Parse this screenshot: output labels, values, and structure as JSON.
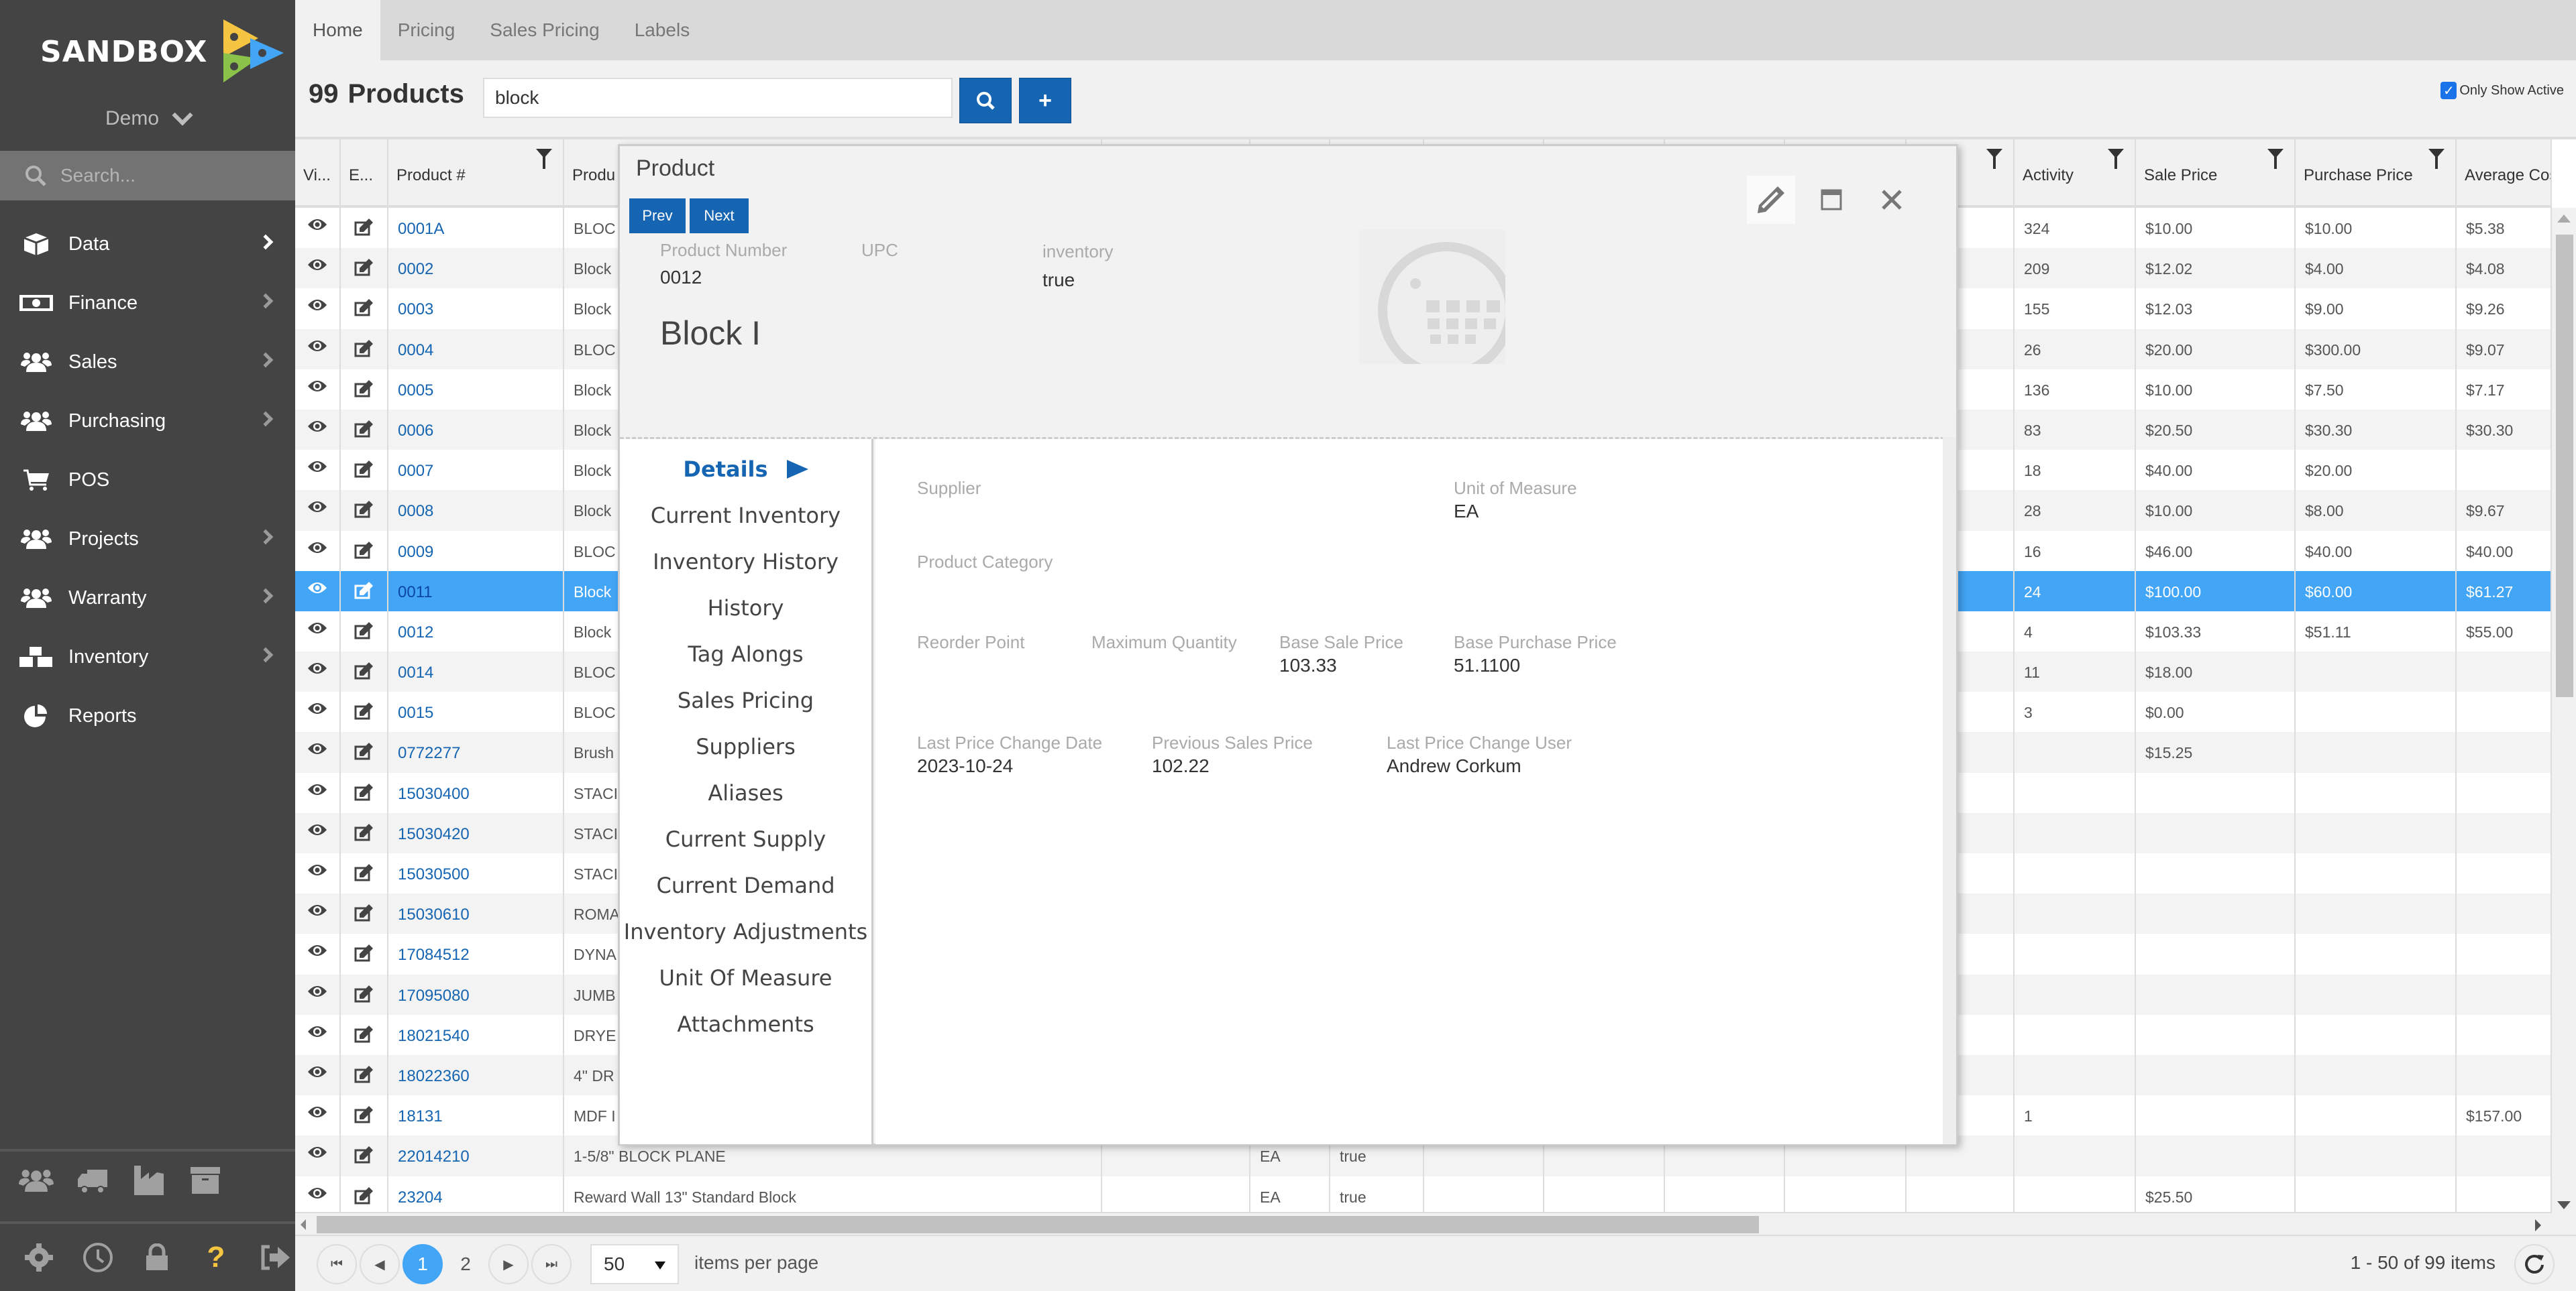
{
  "sidebar": {
    "brand": "SANDBOX",
    "tenant": "Demo",
    "search_placeholder": "Search...",
    "items": [
      {
        "label": "Data",
        "icon": "cube-icon",
        "has_arrow": true
      },
      {
        "label": "Finance",
        "icon": "money-bill-icon",
        "has_arrow": true
      },
      {
        "label": "Sales",
        "icon": "users-icon",
        "has_arrow": true
      },
      {
        "label": "Purchasing",
        "icon": "users-icon",
        "has_arrow": true
      },
      {
        "label": "POS",
        "icon": "shopping-cart-icon",
        "has_arrow": false
      },
      {
        "label": "Projects",
        "icon": "users-icon",
        "has_arrow": true
      },
      {
        "label": "Warranty",
        "icon": "users-icon",
        "has_arrow": true
      },
      {
        "label": "Inventory",
        "icon": "cubes-icon",
        "has_arrow": true
      },
      {
        "label": "Reports",
        "icon": "pie-chart-icon",
        "has_arrow": false
      }
    ],
    "quick_icons": [
      "users-icon",
      "truck-icon",
      "industry-icon",
      "archive-icon"
    ],
    "bottom_icons": [
      "gear-icon",
      "clock-icon",
      "lock-icon",
      "help-icon",
      "sign-out-icon"
    ],
    "help_color": "#f5c542"
  },
  "tabs": [
    {
      "label": "Home",
      "active": true
    },
    {
      "label": "Pricing",
      "active": false
    },
    {
      "label": "Sales Pricing",
      "active": false
    },
    {
      "label": "Labels",
      "active": false
    }
  ],
  "header": {
    "count": "99",
    "title": "Products",
    "search_value": "block",
    "only_show_active_label": "Only Show Active",
    "only_show_active_checked": true
  },
  "grid": {
    "columns": [
      "Vi...",
      "E...",
      "Product #",
      "Produ",
      "",
      "",
      "",
      "",
      "",
      "",
      "",
      "",
      "Activity",
      "Sale Price",
      "Purchase Price",
      "Average Cos"
    ],
    "rows": [
      {
        "num": "0001A",
        "desc": "BLOC",
        "uom": "",
        "active": "",
        "activity": "324",
        "sale": "$10.00",
        "purchase": "$10.00",
        "avg": "$5.38"
      },
      {
        "num": "0002",
        "desc": "Block",
        "uom": "",
        "active": "",
        "activity": "209",
        "sale": "$12.02",
        "purchase": "$4.00",
        "avg": "$4.08"
      },
      {
        "num": "0003",
        "desc": "Block",
        "uom": "",
        "active": "",
        "activity": "155",
        "sale": "$12.03",
        "purchase": "$9.00",
        "avg": "$9.26"
      },
      {
        "num": "0004",
        "desc": "BLOC",
        "uom": "",
        "active": "",
        "activity": "26",
        "sale": "$20.00",
        "purchase": "$300.00",
        "avg": "$9.07"
      },
      {
        "num": "0005",
        "desc": "Block",
        "uom": "",
        "active": "",
        "activity": "136",
        "sale": "$10.00",
        "purchase": "$7.50",
        "avg": "$7.17"
      },
      {
        "num": "0006",
        "desc": "Block",
        "uom": "",
        "active": "",
        "activity": "83",
        "sale": "$20.50",
        "purchase": "$30.30",
        "avg": "$30.30"
      },
      {
        "num": "0007",
        "desc": "Block",
        "uom": "",
        "active": "",
        "activity": "18",
        "sale": "$40.00",
        "purchase": "$20.00",
        "avg": ""
      },
      {
        "num": "0008",
        "desc": "Block",
        "uom": "",
        "active": "",
        "activity": "28",
        "sale": "$10.00",
        "purchase": "$8.00",
        "avg": "$9.67"
      },
      {
        "num": "0009",
        "desc": "BLOC",
        "uom": "",
        "active": "",
        "activity": "16",
        "sale": "$46.00",
        "purchase": "$40.00",
        "avg": "$40.00"
      },
      {
        "num": "0011",
        "desc": "Block",
        "uom": "",
        "active": "",
        "activity": "24",
        "sale": "$100.00",
        "purchase": "$60.00",
        "avg": "$61.27",
        "selected": true
      },
      {
        "num": "0012",
        "desc": "Block",
        "uom": "",
        "active": "",
        "activity": "4",
        "sale": "$103.33",
        "purchase": "$51.11",
        "avg": "$55.00"
      },
      {
        "num": "0014",
        "desc": "BLOC",
        "uom": "",
        "active": "",
        "activity": "11",
        "sale": "$18.00",
        "purchase": "",
        "avg": ""
      },
      {
        "num": "0015",
        "desc": "BLOC",
        "uom": "",
        "active": "",
        "activity": "3",
        "sale": "$0.00",
        "purchase": "",
        "avg": ""
      },
      {
        "num": "0772277",
        "desc": "Brush",
        "uom": "",
        "active": "",
        "activity": "",
        "sale": "$15.25",
        "purchase": "",
        "avg": ""
      },
      {
        "num": "15030400",
        "desc": "STACI",
        "uom": "",
        "active": "",
        "activity": "",
        "sale": "",
        "purchase": "",
        "avg": ""
      },
      {
        "num": "15030420",
        "desc": "STACI",
        "uom": "",
        "active": "",
        "activity": "",
        "sale": "",
        "purchase": "",
        "avg": ""
      },
      {
        "num": "15030500",
        "desc": "STACI",
        "uom": "",
        "active": "",
        "activity": "",
        "sale": "",
        "purchase": "",
        "avg": ""
      },
      {
        "num": "15030610",
        "desc": "ROMA",
        "uom": "",
        "active": "",
        "activity": "",
        "sale": "",
        "purchase": "",
        "avg": ""
      },
      {
        "num": "17084512",
        "desc": "DYNA",
        "uom": "",
        "active": "",
        "activity": "",
        "sale": "",
        "purchase": "",
        "avg": ""
      },
      {
        "num": "17095080",
        "desc": "JUMB",
        "uom": "",
        "active": "",
        "activity": "",
        "sale": "",
        "purchase": "",
        "avg": ""
      },
      {
        "num": "18021540",
        "desc": "DRYE",
        "uom": "",
        "active": "",
        "activity": "",
        "sale": "",
        "purchase": "",
        "avg": ""
      },
      {
        "num": "18022360",
        "desc": "4\" DR",
        "uom": "",
        "active": "",
        "activity": "",
        "sale": "",
        "purchase": "",
        "avg": ""
      },
      {
        "num": "18131",
        "desc": "MDF I",
        "uom": "",
        "active": "",
        "activity": "1",
        "sale": "",
        "purchase": "",
        "avg": "$157.00"
      },
      {
        "num": "22014210",
        "desc": "1-5/8\" BLOCK PLANE",
        "uom": "EA",
        "active": "true",
        "activity": "",
        "sale": "",
        "purchase": "",
        "avg": ""
      },
      {
        "num": "23204",
        "desc": "Reward Wall 13\" Standard Block",
        "uom": "EA",
        "active": "true",
        "activity": "",
        "sale": "$25.50",
        "purchase": "",
        "avg": ""
      }
    ]
  },
  "pager": {
    "pages": [
      "1",
      "2"
    ],
    "current_page": "1",
    "page_size": "50",
    "items_per_page_label": "items per page",
    "range_text": "1 - 50 of 99 items"
  },
  "modal": {
    "title": "Product",
    "prev_label": "Prev",
    "next_label": "Next",
    "fields_top": {
      "product_number_label": "Product Number",
      "product_number": "0012",
      "upc_label": "UPC",
      "upc": "",
      "inventory_label": "inventory",
      "inventory": "true"
    },
    "product_name": "Block I",
    "nav": [
      {
        "label": "Details",
        "active": true
      },
      {
        "label": "Current Inventory"
      },
      {
        "label": "Inventory History"
      },
      {
        "label": "History"
      },
      {
        "label": "Tag Alongs"
      },
      {
        "label": "Sales Pricing"
      },
      {
        "label": "Suppliers"
      },
      {
        "label": "Aliases"
      },
      {
        "label": "Current Supply"
      },
      {
        "label": "Current Demand"
      },
      {
        "label": "Inventory Adjustments"
      },
      {
        "label": "Unit Of Measure"
      },
      {
        "label": "Attachments"
      }
    ],
    "details": {
      "supplier_label": "Supplier",
      "supplier": "",
      "uom_label": "Unit of Measure",
      "uom": "EA",
      "category_label": "Product Category",
      "category": "",
      "reorder_label": "Reorder Point",
      "reorder": "",
      "max_qty_label": "Maximum Quantity",
      "max_qty": "",
      "base_sale_label": "Base Sale Price",
      "base_sale": "103.33",
      "base_purchase_label": "Base Purchase Price",
      "base_purchase": "51.1100",
      "last_change_date_label": "Last Price Change Date",
      "last_change_date": "2023-10-24",
      "prev_sales_label": "Previous Sales Price",
      "prev_sales": "102.22",
      "last_change_user_label": "Last Price Change User",
      "last_change_user": "Andrew Corkum"
    }
  },
  "colors": {
    "accent": "#1565b3",
    "selected_row": "#42a5f5",
    "sidebar_bg": "#444444"
  }
}
